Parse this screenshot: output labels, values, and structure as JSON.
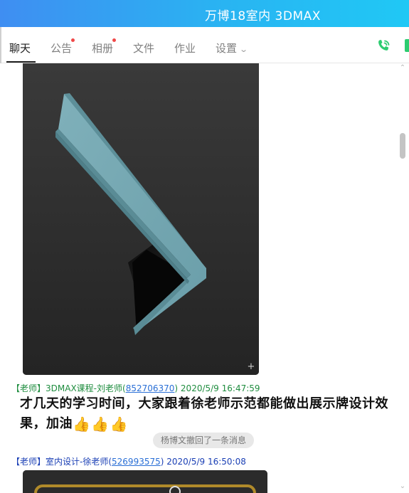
{
  "window": {
    "title": "万博18室内 3DMAX"
  },
  "tabs": [
    {
      "label": "聊天",
      "active": true
    },
    {
      "label": "公告",
      "badge": true
    },
    {
      "label": "相册",
      "badge": true
    },
    {
      "label": "文件"
    },
    {
      "label": "作业"
    },
    {
      "label": "设置"
    }
  ],
  "actions": {
    "call_icon": "phone-icon"
  },
  "messages": [
    {
      "role": "【老师】",
      "name": "3DMAX课程-刘老师(",
      "qq": "852706370",
      "close": ")",
      "time": "2020/5/9 16:47:59",
      "text": "才几天的学习时间，大家跟着徐老师示范都能做出展示牌设计效果，加油",
      "emojis": [
        "👍",
        "👍",
        "👍"
      ]
    },
    {
      "role": "【老师】",
      "name": "室内设计-徐老师(",
      "qq": "526993575",
      "close": ")",
      "time": "2020/5/9 16:50:08"
    }
  ],
  "system": {
    "recall_notice": "杨博文撤回了一条消息"
  },
  "colors": {
    "accent": "#3f8ef2",
    "teacher_green": "#1f8d3f",
    "teacher_blue": "#1a3fb5",
    "badge": "#f04848"
  }
}
